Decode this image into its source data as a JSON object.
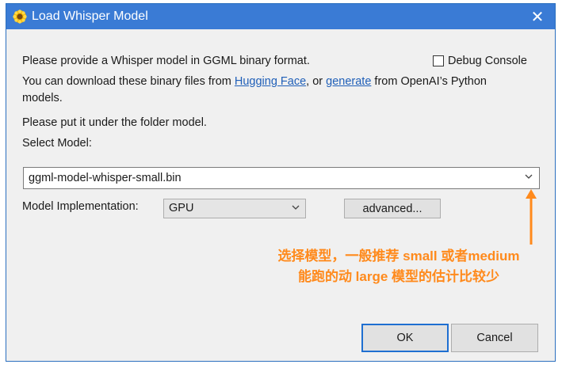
{
  "window": {
    "title": "Load Whisper Model",
    "close_glyph": "✕"
  },
  "body_text": {
    "line1": "Please provide a Whisper model in GGML binary format.",
    "line2_prefix": "You can download these binary files from ",
    "link_hugging_face": "Hugging Face",
    "line2_middle": ", or ",
    "link_generate": "generate",
    "line2_suffix": " from OpenAI’s Python",
    "line3": "models.",
    "line4": "Please put it under the folder model.",
    "select_label": "Select Model:"
  },
  "debug_console": {
    "label": "Debug Console",
    "checked": false
  },
  "model_select": {
    "value": "ggml-model-whisper-small.bin",
    "chevron_icon": "chevron-down-icon"
  },
  "implementation": {
    "label": "Model Implementation:",
    "value": "GPU",
    "chevron_icon": "chevron-down-icon"
  },
  "buttons": {
    "advanced": "advanced...",
    "ok": "OK",
    "cancel": "Cancel"
  },
  "annotation": {
    "line1": "选择模型，一般推荐 small 或者medium",
    "line2": "能跑的动 large 模型的估计比较少",
    "color": "#ff8a1c"
  },
  "colors": {
    "titlebar": "#3a7bd5",
    "link": "#1f5fb8",
    "ok_border": "#1f6fd1"
  }
}
